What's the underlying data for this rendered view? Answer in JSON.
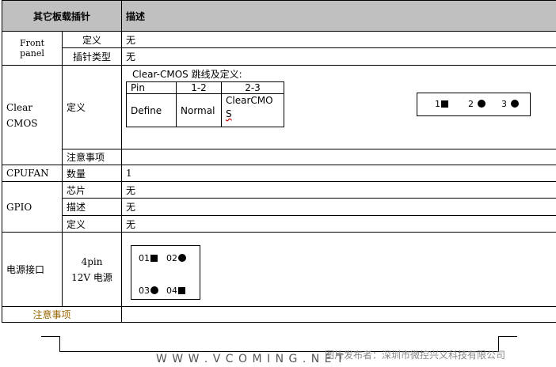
{
  "header": {
    "col1": "其它板载插针",
    "col2": "描述"
  },
  "front_panel": {
    "label": "Front panel",
    "rows": [
      {
        "key": "定义",
        "value": "无"
      },
      {
        "key": "插针类型",
        "value": "无"
      }
    ]
  },
  "clear_cmos": {
    "label_line1": "Clear",
    "label_line2": "CMOS",
    "key_def": "定义",
    "desc": "Clear-CMOS 跳线及定义:",
    "table": {
      "header": [
        "Pin",
        "1-2",
        "2-3"
      ],
      "row": [
        "Define",
        "Normal",
        "ClearCMO",
        "S"
      ]
    },
    "pins": [
      "1",
      "2",
      "3"
    ],
    "key_note": "注意事项",
    "note_value": ""
  },
  "cpufan": {
    "label": "CPUFAN",
    "key": "数量",
    "value": "1"
  },
  "gpio": {
    "label": "GPIO",
    "rows": [
      {
        "key": "芯片",
        "value": "无"
      },
      {
        "key": "描述",
        "value": "无"
      },
      {
        "key": "定义",
        "value": "无"
      }
    ]
  },
  "power": {
    "label": "电源接口",
    "key_line1": "4pin",
    "key_line2": "12V 电源",
    "pins": [
      "01",
      "02",
      "03",
      "04"
    ]
  },
  "notes": {
    "label": "注意事项",
    "value": ""
  },
  "footer": {
    "website": "W W W . V C O M I N G . N E T",
    "publisher": "图片发布者：深圳市微控兴义科技有限公司"
  }
}
